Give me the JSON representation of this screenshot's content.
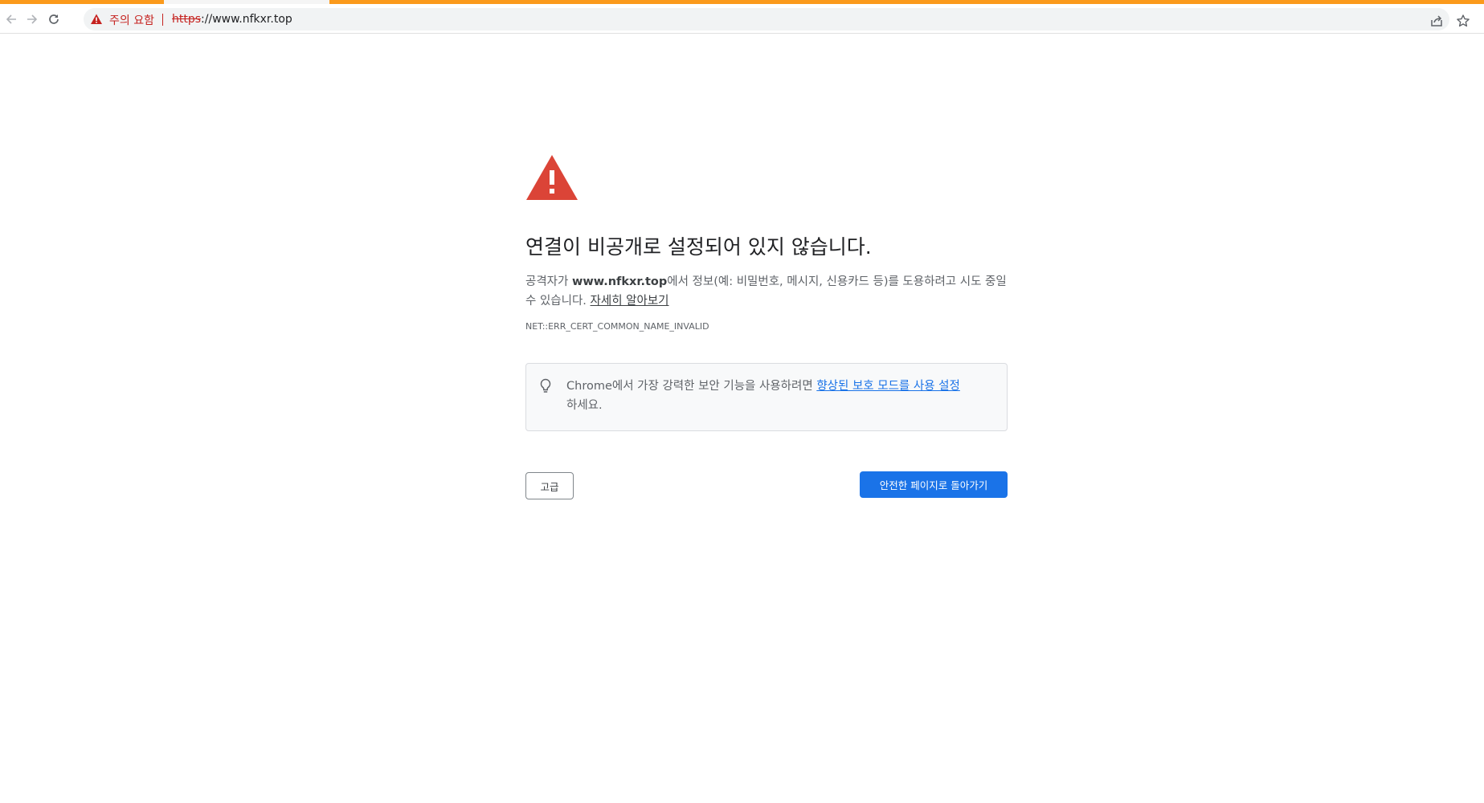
{
  "browser": {
    "security_label": "주의 요함",
    "url_scheme": "https",
    "url_rest": "://www.nfkxr.top",
    "accent_color": "#fb9a1c",
    "warning_color": "#c5221f"
  },
  "page": {
    "heading": "연결이 비공개로 설정되어 있지 않습니다.",
    "explain_prefix": "공격자가 ",
    "explain_host": "www.nfkxr.top",
    "explain_suffix": "에서 정보(예: 비밀번호, 메시지, 신용카드 등)를 도용하려고 시도 중일 수 있습니다. ",
    "learn_more_link": "자세히 알아보기",
    "error_code": "NET::ERR_CERT_COMMON_NAME_INVALID",
    "tip_prefix": "Chrome에서 가장 강력한 보안 기능을 사용하려면 ",
    "tip_link": "향상된 보호 모드를 사용 설정",
    "tip_suffix": "하세요.",
    "advanced_button": "고급",
    "back_button": "안전한 페이지로 돌아가기",
    "primary_color": "#1a73e8"
  },
  "icons": {
    "back": "arrow-left-icon",
    "forward": "arrow-right-icon",
    "reload": "reload-icon",
    "warning": "warning-triangle-icon",
    "share": "share-icon",
    "bookmark": "star-icon",
    "tip": "lightbulb-icon"
  }
}
